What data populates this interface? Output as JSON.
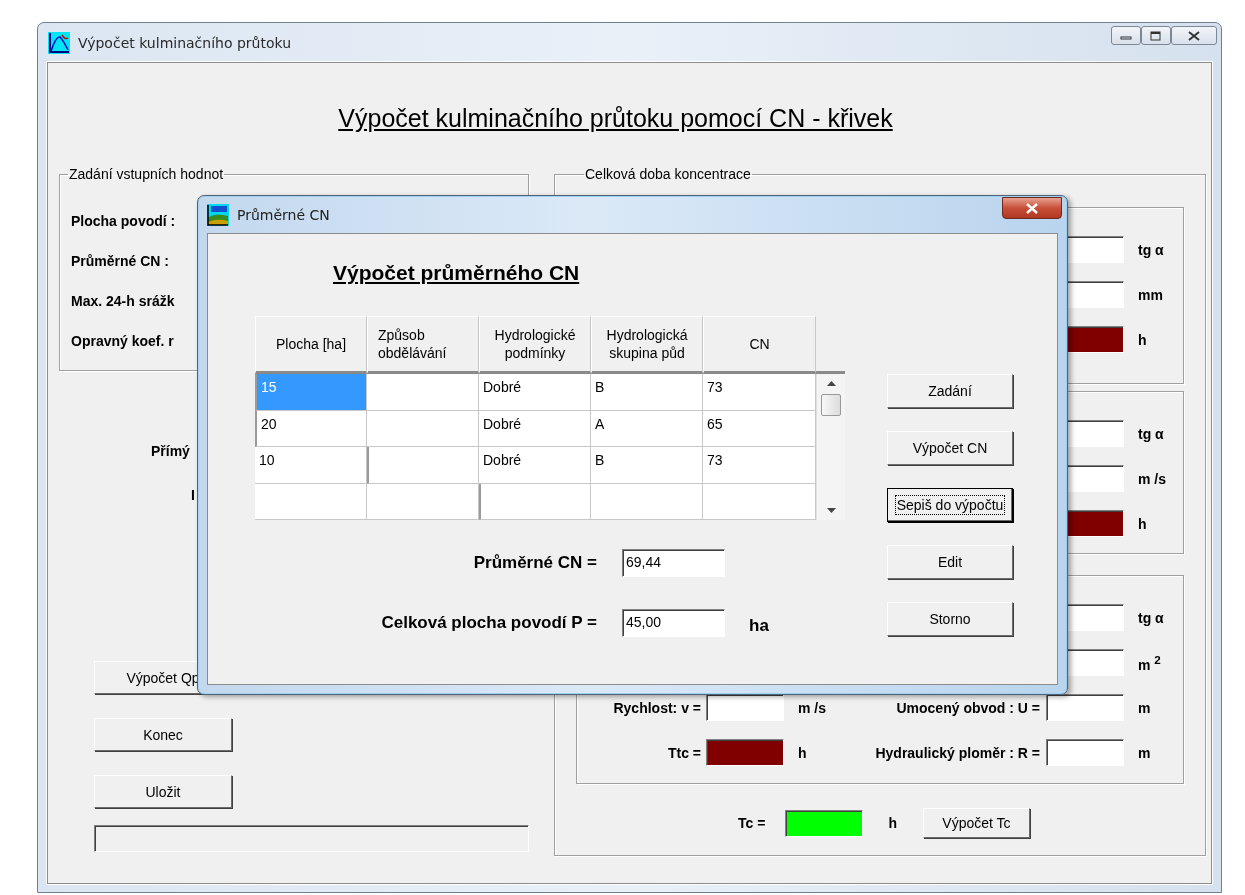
{
  "window": {
    "title": "Výpočet kulminačního průtoku"
  },
  "heading": "Výpočet kulminačního průtoku pomocí CN - křivek",
  "input_group": {
    "title": "Zadání vstupních hodnot",
    "labels": [
      "Plocha povodí :",
      "Průměrné CN :",
      "Max. 24-h srážk",
      "Opravný koef. r"
    ]
  },
  "left_labels": [
    "Přímý",
    "I"
  ],
  "left_buttons": [
    "Výpočet Qp",
    "Konec",
    "Uložit"
  ],
  "concentration_group": {
    "title": "Celková doba koncentrace",
    "sections": [
      {
        "rows": [
          {
            "right": {
              "kind": "input",
              "unit": "tg α"
            }
          },
          {
            "right": {
              "kind": "input",
              "unit": "mm"
            }
          },
          {
            "right": {
              "kind": "result",
              "unit": "h"
            }
          }
        ]
      },
      {
        "rows": [
          {
            "right": {
              "kind": "input",
              "unit": "tg α"
            }
          },
          {
            "right": {
              "kind": "input",
              "unit": "m /s"
            }
          },
          {
            "right": {
              "kind": "result",
              "unit": "h"
            }
          }
        ]
      },
      {
        "rows": [
          {
            "right": {
              "kind": "input",
              "unit": "tg α"
            }
          },
          {
            "right": {
              "kind": "input",
              "unit": "m $^{2}$"
            }
          },
          {
            "left": {
              "label": "Rychlost: v =",
              "kind": "input",
              "unit": "m /s"
            },
            "right": {
              "label": "Umocený obvod : U =",
              "kind": "input",
              "unit": "m"
            }
          },
          {
            "left": {
              "label": "Ttc =",
              "kind": "result",
              "unit": "h"
            },
            "right": {
              "label": "Hydraulický ploměr : R =",
              "kind": "input",
              "unit": "m"
            }
          }
        ]
      }
    ],
    "total": {
      "label": "Tc =",
      "kind": "total",
      "unit": "h",
      "button": "Výpočet Tc"
    }
  },
  "dialog": {
    "title": "Průměrné CN",
    "heading": "Výpočet průměrného CN",
    "table": {
      "columns": [
        "Plocha [ha]",
        "Způsob obdělávání",
        "Hydrologické podmínky",
        "Hydrologická skupina půd",
        "CN"
      ],
      "rows": [
        {
          "area": "15",
          "conditions": "Dobré",
          "soil_group": "B",
          "cn": "73",
          "selected": true
        },
        {
          "area": "20",
          "conditions": "Dobré",
          "soil_group": "A",
          "cn": "65",
          "selected": false
        },
        {
          "area": "10",
          "conditions": "Dobré",
          "soil_group": "B",
          "cn": "73",
          "selected": false
        }
      ]
    },
    "results": [
      {
        "label": "Průměrné CN =",
        "value": "69,44"
      },
      {
        "label": "Celková plocha povodí P =",
        "value": "45,00",
        "unit": "ha"
      }
    ],
    "buttons": [
      {
        "label": "Zadání",
        "focused": false
      },
      {
        "label": "Výpočet CN",
        "focused": false
      },
      {
        "label": "Sepiš do výpočtu",
        "focused": true
      },
      {
        "label": "Edit",
        "focused": false
      },
      {
        "label": "Storno",
        "focused": false
      }
    ]
  }
}
